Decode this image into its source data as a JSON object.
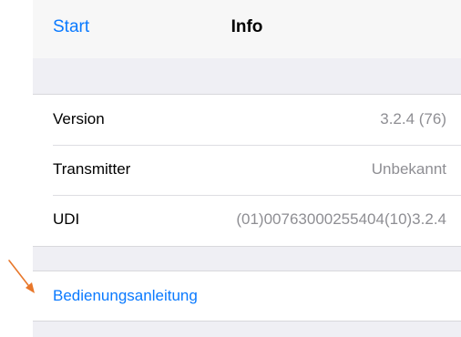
{
  "navbar": {
    "back_label": "Start",
    "title": "Info"
  },
  "info": {
    "rows": [
      {
        "label": "Version",
        "value": "3.2.4 (76)"
      },
      {
        "label": "Transmitter",
        "value": "Unbekannt"
      },
      {
        "label": "UDI",
        "value": "(01)00763000255404(10)3.2.4"
      }
    ]
  },
  "manual": {
    "link_label": "Bedienungsanleitung"
  },
  "colors": {
    "accent": "#0a7aff",
    "annotation_arrow": "#e8772a",
    "group_background": "#efeff4"
  },
  "icons": {
    "annotation": "arrow-down-right-icon"
  }
}
